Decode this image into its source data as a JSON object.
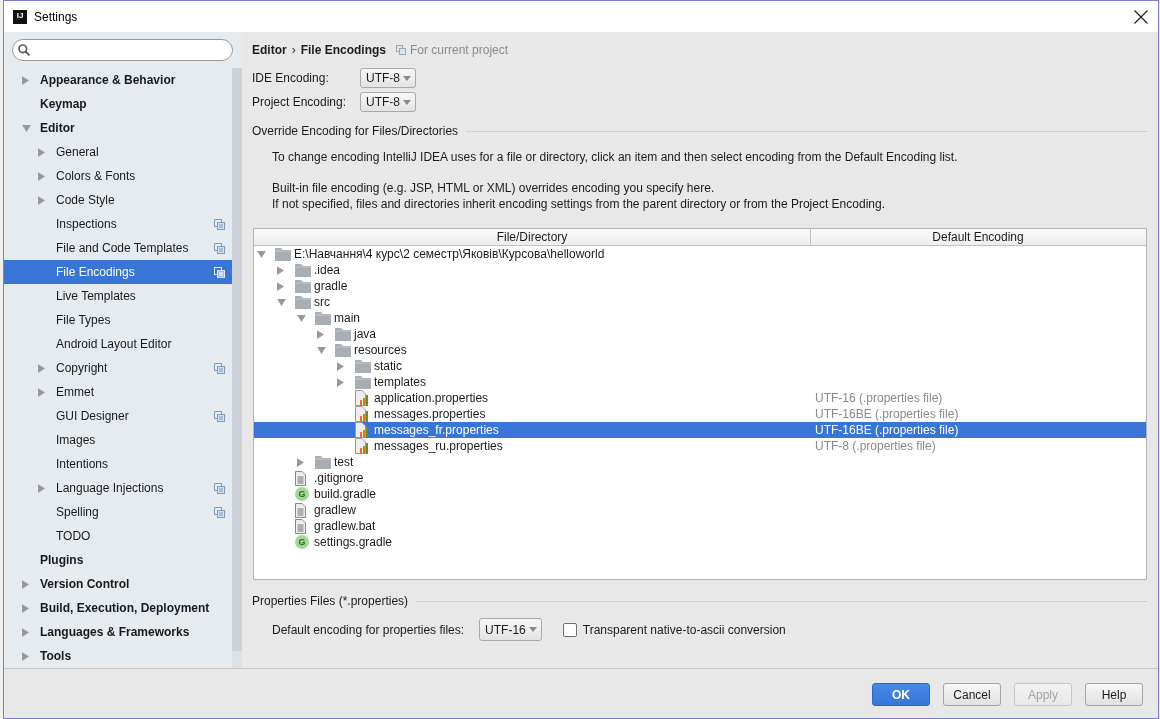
{
  "window": {
    "logo": "IJ",
    "title": "Settings"
  },
  "sidebar": {
    "items": [
      {
        "label": "Appearance & Behavior",
        "kind": "group",
        "expanded": false,
        "selected": false,
        "project_level": false
      },
      {
        "label": "Keymap",
        "kind": "page",
        "selected": false,
        "project_level": false
      },
      {
        "label": "Editor",
        "kind": "group",
        "expanded": true,
        "selected": false,
        "project_level": false,
        "children": [
          {
            "label": "General",
            "kind": "group",
            "expanded": false,
            "selected": false,
            "project_level": false
          },
          {
            "label": "Colors & Fonts",
            "kind": "group",
            "expanded": false,
            "selected": false,
            "project_level": false
          },
          {
            "label": "Code Style",
            "kind": "group",
            "expanded": false,
            "selected": false,
            "project_level": false
          },
          {
            "label": "Inspections",
            "kind": "page",
            "selected": false,
            "project_level": true
          },
          {
            "label": "File and Code Templates",
            "kind": "page",
            "selected": false,
            "project_level": true
          },
          {
            "label": "File Encodings",
            "kind": "page",
            "selected": true,
            "project_level": true
          },
          {
            "label": "Live Templates",
            "kind": "page",
            "selected": false,
            "project_level": false
          },
          {
            "label": "File Types",
            "kind": "page",
            "selected": false,
            "project_level": false
          },
          {
            "label": "Android Layout Editor",
            "kind": "page",
            "selected": false,
            "project_level": false
          },
          {
            "label": "Copyright",
            "kind": "group",
            "expanded": false,
            "selected": false,
            "project_level": true
          },
          {
            "label": "Emmet",
            "kind": "group",
            "expanded": false,
            "selected": false,
            "project_level": false
          },
          {
            "label": "GUI Designer",
            "kind": "page",
            "selected": false,
            "project_level": true
          },
          {
            "label": "Images",
            "kind": "page",
            "selected": false,
            "project_level": false
          },
          {
            "label": "Intentions",
            "kind": "page",
            "selected": false,
            "project_level": false
          },
          {
            "label": "Language Injections",
            "kind": "group",
            "expanded": false,
            "selected": false,
            "project_level": true
          },
          {
            "label": "Spelling",
            "kind": "page",
            "selected": false,
            "project_level": true
          },
          {
            "label": "TODO",
            "kind": "page",
            "selected": false,
            "project_level": false
          }
        ]
      },
      {
        "label": "Plugins",
        "kind": "page",
        "selected": false,
        "project_level": false
      },
      {
        "label": "Version Control",
        "kind": "group",
        "expanded": false,
        "selected": false,
        "project_level": false
      },
      {
        "label": "Build, Execution, Deployment",
        "kind": "group",
        "expanded": false,
        "selected": false,
        "project_level": false
      },
      {
        "label": "Languages & Frameworks",
        "kind": "group",
        "expanded": false,
        "selected": false,
        "project_level": false
      },
      {
        "label": "Tools",
        "kind": "group",
        "expanded": false,
        "selected": false,
        "project_level": false
      }
    ]
  },
  "breadcrumb": {
    "parts": [
      "Editor",
      "File Encodings"
    ],
    "separator": "›",
    "scope": "For current project"
  },
  "encodings": [
    {
      "label": "IDE Encoding:",
      "value": "UTF-8"
    },
    {
      "label": "Project Encoding:",
      "value": "UTF-8"
    }
  ],
  "override_section": {
    "title": "Override Encoding for Files/Directories",
    "paragraphs": [
      [
        "To change encoding IntelliJ IDEA uses for a file or directory, click an item and then select encoding from the Default Encoding list."
      ],
      [
        "Built-in file encoding (e.g. JSP, HTML or XML) overrides encoding you specify here.",
        "If not specified, files and directories inherit encoding settings from the parent directory or from the Project Encoding."
      ]
    ]
  },
  "table": {
    "columns": [
      "File/Directory",
      "Default Encoding"
    ],
    "rows": [
      {
        "name": "E:\\Навчання\\4 курс\\2 семестр\\Яковів\\Курсова\\helloworld",
        "kind": "folder",
        "expanded": true,
        "selected": false,
        "children": [
          {
            "name": ".idea",
            "kind": "folder",
            "expanded": false,
            "selected": false
          },
          {
            "name": "gradle",
            "kind": "folder",
            "expanded": false,
            "selected": false
          },
          {
            "name": "src",
            "kind": "folder",
            "expanded": true,
            "selected": false,
            "children": [
              {
                "name": "main",
                "kind": "folder",
                "expanded": true,
                "selected": false,
                "children": [
                  {
                    "name": "java",
                    "kind": "folder",
                    "expanded": false,
                    "selected": false
                  },
                  {
                    "name": "resources",
                    "kind": "folder",
                    "expanded": true,
                    "selected": false,
                    "children": [
                      {
                        "name": "static",
                        "kind": "folder",
                        "expanded": false,
                        "selected": false
                      },
                      {
                        "name": "templates",
                        "kind": "folder",
                        "expanded": false,
                        "selected": false
                      },
                      {
                        "name": "application.properties",
                        "kind": "properties",
                        "selected": false,
                        "encoding": "UTF-16 (.properties file)"
                      },
                      {
                        "name": "messages.properties",
                        "kind": "properties",
                        "selected": false,
                        "encoding": "UTF-16BE (.properties file)"
                      },
                      {
                        "name": "messages_fr.properties",
                        "kind": "properties",
                        "selected": true,
                        "encoding": "UTF-16BE (.properties file)"
                      },
                      {
                        "name": "messages_ru.properties",
                        "kind": "properties",
                        "selected": false,
                        "encoding": "UTF-8 (.properties file)"
                      }
                    ]
                  }
                ]
              },
              {
                "name": "test",
                "kind": "folder",
                "expanded": false,
                "selected": false
              }
            ]
          },
          {
            "name": ".gitignore",
            "kind": "text",
            "selected": false
          },
          {
            "name": "build.gradle",
            "kind": "gradle",
            "icon_letter": "G",
            "selected": false
          },
          {
            "name": "gradlew",
            "kind": "text",
            "selected": false
          },
          {
            "name": "gradlew.bat",
            "kind": "text",
            "selected": false
          },
          {
            "name": "settings.gradle",
            "kind": "gradle",
            "icon_letter": "G",
            "selected": false
          }
        ]
      }
    ]
  },
  "properties_section": {
    "title": "Properties Files (*.properties)",
    "label": "Default encoding for properties files:",
    "value": "UTF-16",
    "native_to_ascii": {
      "label": "Transparent native-to-ascii conversion",
      "checked": false
    }
  },
  "buttons": [
    {
      "label": "OK",
      "default": true,
      "disabled": false
    },
    {
      "label": "Cancel",
      "default": false,
      "disabled": false
    },
    {
      "label": "Apply",
      "default": false,
      "disabled": true
    },
    {
      "label": "Help",
      "default": false,
      "disabled": false
    }
  ]
}
